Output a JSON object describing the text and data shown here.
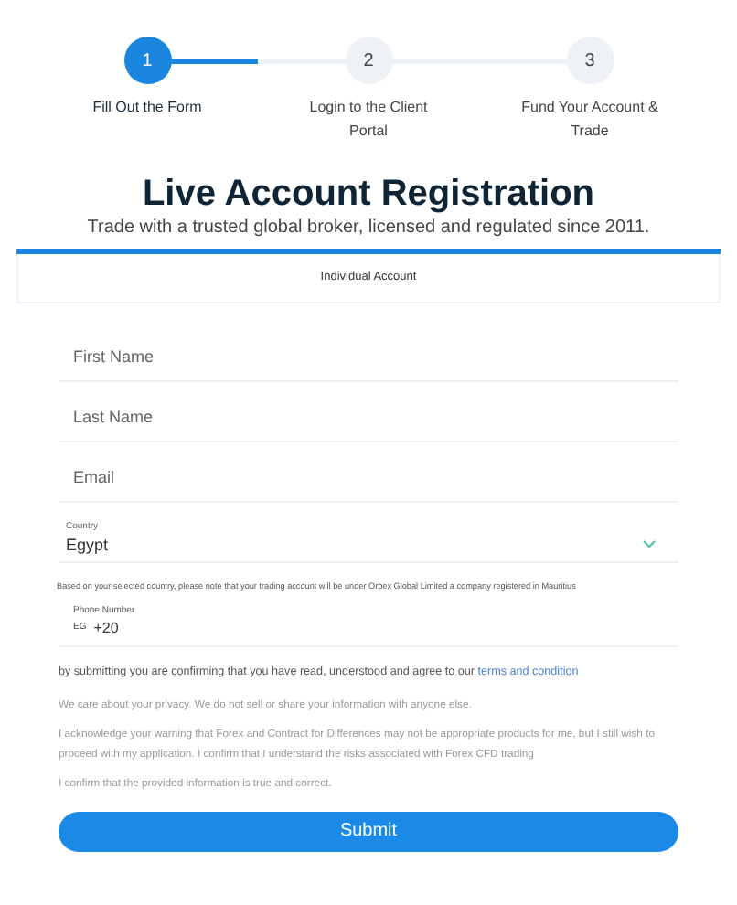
{
  "steps": [
    {
      "number": "1",
      "label": "Fill Out the Form",
      "selected": true
    },
    {
      "number": "2",
      "label": "Login to the Client Portal",
      "selected": false
    },
    {
      "number": "3",
      "label": "Fund Your Account & Trade",
      "selected": false
    }
  ],
  "title": "Live Account Registration",
  "subtitle": "Trade with a trusted global broker, licensed and regulated since 2011.",
  "tabs": [
    {
      "label": "Individual Account",
      "selected": true
    }
  ],
  "fields": [
    {
      "kind": "text",
      "placeholder": "First Name"
    },
    {
      "kind": "text",
      "placeholder": "Last Name"
    },
    {
      "kind": "text",
      "placeholder": "Email"
    },
    {
      "kind": "select",
      "label": "Country",
      "value": "Egypt"
    }
  ],
  "country_note": "Based on your selected country, please note that your trading account will be under Orbex Global Limited a company registered in Mauritius",
  "phone": {
    "label": "Phone Number",
    "country_code": "EG",
    "value": "+20"
  },
  "agreement": {
    "text": "by submitting you are confirming that you have read, understood and agree to our",
    "link": "terms and condition"
  },
  "notices": [
    "We care about your privacy. We do not sell or share your information with anyone else.",
    "I acknowledge your warning that Forex and Contract for Differences may not be appropriate products for me, but I still wish to proceed with my application. I confirm that I understand the risks associated with Forex CFD trading",
    "I confirm that the provided information is true and correct."
  ],
  "submit": "Submit"
}
